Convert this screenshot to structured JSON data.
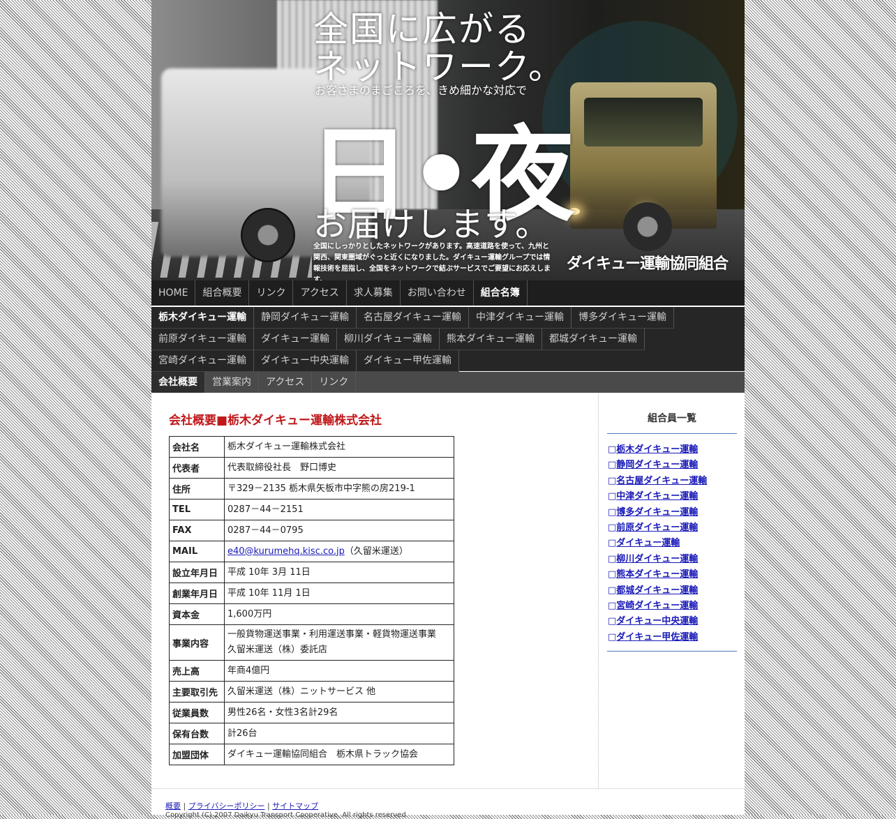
{
  "hero": {
    "headline1": "全国に広がる",
    "headline2": "ネットワーク。",
    "subline": "お客さまのまごころを、きめ細かな対応で",
    "big_text": "日•夜",
    "headline3": "お届けします。",
    "description": "全国にしっかりとしたネットワークがあります。高速道路を使って、九州と関西、関東圏域がぐっと近くになりました。ダイキュー運輸グループでは情報技術を屈指し、全国をネットワークで結ぶサービスでご要望にお応えします。",
    "org_name": "ダイキュー運輸協同組合"
  },
  "nav_main": [
    {
      "label": "HOME",
      "active": false
    },
    {
      "label": "組合概要",
      "active": false
    },
    {
      "label": "リンク",
      "active": false
    },
    {
      "label": "アクセス",
      "active": false
    },
    {
      "label": "求人募集",
      "active": false
    },
    {
      "label": "お問い合わせ",
      "active": false
    },
    {
      "label": "組合名簿",
      "active": true
    }
  ],
  "nav_members": [
    {
      "label": "栃木ダイキュー運輸",
      "active": true
    },
    {
      "label": "静岡ダイキュー運輸",
      "active": false
    },
    {
      "label": "名古屋ダイキュー運輸",
      "active": false
    },
    {
      "label": "中津ダイキュー運輸",
      "active": false
    },
    {
      "label": "博多ダイキュー運輸",
      "active": false
    },
    {
      "label": "前原ダイキュー運輸",
      "active": false
    },
    {
      "label": "ダイキュー運輸",
      "active": false
    },
    {
      "label": "柳川ダイキュー運輸",
      "active": false
    },
    {
      "label": "熊本ダイキュー運輸",
      "active": false
    },
    {
      "label": "都城ダイキュー運輸",
      "active": false
    },
    {
      "label": "宮崎ダイキュー運輸",
      "active": false
    },
    {
      "label": "ダイキュー中央運輸",
      "active": false
    },
    {
      "label": "ダイキュー甲佐運輸",
      "active": false
    }
  ],
  "nav_sub": [
    {
      "label": "会社概要",
      "active": true
    },
    {
      "label": "営業案内",
      "active": false
    },
    {
      "label": "アクセス",
      "active": false
    },
    {
      "label": "リンク",
      "active": false
    }
  ],
  "main": {
    "title": "会社概要■栃木ダイキュー運輸株式会社",
    "rows": [
      {
        "label": "会社名",
        "value": "栃木ダイキュー運輸株式会社"
      },
      {
        "label": "代表者",
        "value": "代表取締役社長　野口博史"
      },
      {
        "label": "住所",
        "value": "〒329－2135 栃木県矢板市中字熊の房219-1"
      },
      {
        "label": "TEL",
        "value": "0287－44－2151"
      },
      {
        "label": "FAX",
        "value": "0287－44－0795"
      },
      {
        "label": "MAIL",
        "value": "e40@kurumehq.kisc.co.jp",
        "note": "（久留米運送）"
      },
      {
        "label": "設立年月日",
        "value": "平成 10年 3月 11日"
      },
      {
        "label": "創業年月日",
        "value": "平成 10年 11月 1日"
      },
      {
        "label": "資本金",
        "value": "1,600万円"
      },
      {
        "label": "事業内容",
        "value": "一般貨物運送事業・利用運送事業・軽貨物運送事業",
        "value2": "久留米運送（株）委託店"
      },
      {
        "label": "売上高",
        "value": "年商4億円"
      },
      {
        "label": "主要取引先",
        "value": "久留米運送（株）ニットサービス 他"
      },
      {
        "label": "従業員数",
        "value": "男性26名・女性3名計29名"
      },
      {
        "label": "保有台数",
        "value": "計26台"
      },
      {
        "label": "加盟団体",
        "value": "ダイキュー運輸協同組合　栃木県トラック協会"
      }
    ]
  },
  "sidebar": {
    "title": "組合員一覧",
    "bullet": "□",
    "items": [
      "栃木ダイキュー運輸",
      "静岡ダイキュー運輸",
      "名古屋ダイキュー運輸",
      "中津ダイキュー運輸",
      "博多ダイキュー運輸",
      "前原ダイキュー運輸",
      "ダイキュー運輸",
      "柳川ダイキュー運輸",
      "熊本ダイキュー運輸",
      "都城ダイキュー運輸",
      "宮崎ダイキュー運輸",
      "ダイキュー中央運輸",
      "ダイキュー甲佐運輸"
    ]
  },
  "footer": {
    "links": [
      "概要",
      "プライバシーポリシー",
      "サイトマップ"
    ],
    "separator": "|",
    "copyright": "Copyright (C) 2007 Daikyu Transport Cooperative. All rights reserved."
  }
}
